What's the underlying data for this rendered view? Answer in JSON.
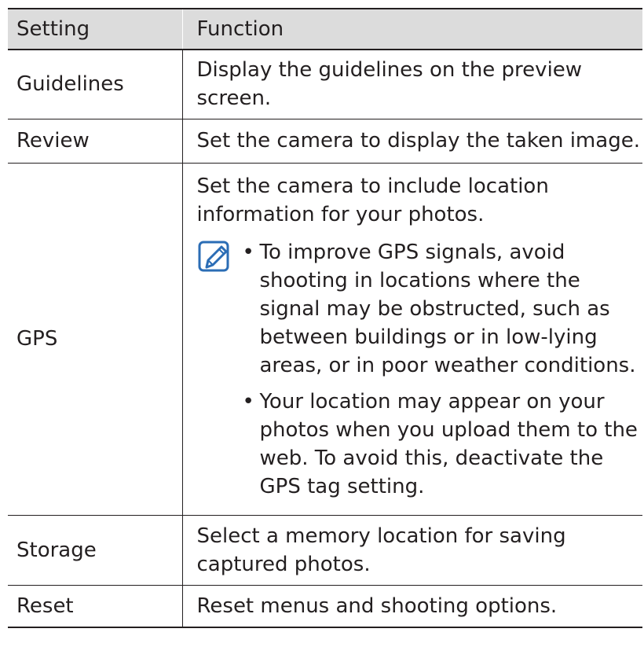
{
  "header": {
    "setting": "Setting",
    "function": "Function"
  },
  "rows": [
    {
      "setting": "Guidelines",
      "function": "Display the guidelines on the preview screen."
    },
    {
      "setting": "Review",
      "function": "Set the camera to display the taken image."
    },
    {
      "setting": "GPS",
      "function": "Set the camera to include location information for your photos.",
      "notes": [
        "To improve GPS signals, avoid shooting in locations where the signal may be obstructed, such as between buildings or in low-lying areas, or in poor weather conditions.",
        "Your location may appear on your photos when you upload them to the web. To avoid this, deactivate the GPS tag setting."
      ],
      "note_icon": "note-pencil-icon",
      "bullet": "•"
    },
    {
      "setting": "Storage",
      "function": "Select a memory location for saving captured photos."
    },
    {
      "setting": "Reset",
      "function": "Reset menus and shooting options."
    }
  ],
  "colors": {
    "text": "#231f20",
    "header_bg": "#dcdcdc",
    "icon": "#2b6db5"
  }
}
